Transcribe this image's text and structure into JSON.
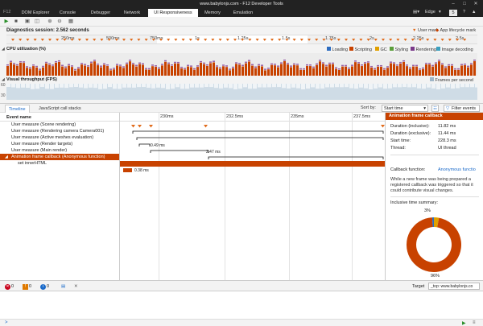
{
  "window": {
    "title": "www.babylonjs.com - F12 Developer Tools"
  },
  "menubar": {
    "tool_id": "F12",
    "tabs": [
      {
        "label": "DOM Explorer",
        "active": false
      },
      {
        "label": "Console",
        "active": false
      },
      {
        "label": "Debugger",
        "active": false
      },
      {
        "label": "Network",
        "active": false
      },
      {
        "label": "UI Responsiveness",
        "active": true
      },
      {
        "label": "Memory",
        "active": false
      },
      {
        "label": "Emulation",
        "active": false
      }
    ],
    "browser": "Edge",
    "counter": "5"
  },
  "session": {
    "label": "Diagnostics session: 2.562 seconds",
    "legend_user_mark": "User mark",
    "legend_lifecycle_mark": "App lifecycle mark",
    "ruler_ticks": [
      "250ms",
      "500ms",
      "750ms",
      "1s",
      "1.25s",
      "1.5s",
      "1.75s",
      "2s",
      "2.25s",
      "2.5s"
    ]
  },
  "cpu": {
    "title": "CPU utilization (%)",
    "legend": [
      {
        "label": "Loading",
        "color": "#2d6cc0"
      },
      {
        "label": "Scripting",
        "color": "#c84200"
      },
      {
        "label": "GC",
        "color": "#e0a000"
      },
      {
        "label": "Styling",
        "color": "#5a9e3a"
      },
      {
        "label": "Rendering",
        "color": "#7a3a8a"
      },
      {
        "label": "Image decoding",
        "color": "#3aa0c0"
      }
    ]
  },
  "fps": {
    "title": "Visual throughput (FPS)",
    "legend": "Frames per second",
    "axis_top": "60",
    "axis_bottom": "30"
  },
  "details_tabs": {
    "timeline": "Timeline",
    "callstacks": "JavaScript call stacks",
    "sort_by": "Sort by:",
    "sort_value": "Start time",
    "filter": "Filter events"
  },
  "events": {
    "header": "Event name",
    "rows": [
      {
        "name": "User measure (Scene rendering)"
      },
      {
        "name": "User measure (Rendering camera Camera001)"
      },
      {
        "name": "User measure (Active meshes evaluation)",
        "duration": "0.49 ms"
      },
      {
        "name": "User measure (Render targets)",
        "duration": "2.47 ms"
      },
      {
        "name": "User measure (Main render)"
      },
      {
        "name": "Animation frame callback (Anonymous function)"
      },
      {
        "name": "set innerHTML",
        "duration": "0.38 ms"
      }
    ]
  },
  "timeline": {
    "ticks": [
      "230ms",
      "232.5ms",
      "235ms",
      "237.5ms"
    ]
  },
  "details": {
    "title": "Animation frame callback",
    "duration_inclusive_label": "Duration (inclusive):",
    "duration_inclusive": "11.82 ms",
    "duration_exclusive_label": "Duration (exclusive):",
    "duration_exclusive": "11.44 ms",
    "start_time_label": "Start time:",
    "start_time": "228.3 ms",
    "thread_label": "Thread:",
    "thread": "UI thread",
    "callback_label": "Callback function:",
    "callback_value": "Anonymous functio",
    "description": "While a new frame was being prepared a registered callback was triggered so that it could contribute visual changes.",
    "summary_title": "Inclusive time summary:",
    "pie": [
      {
        "label": "3%",
        "value": 3,
        "color": "#e0a000"
      },
      {
        "label": "96%",
        "value": 96,
        "color": "#c84200"
      },
      {
        "label": "",
        "value": 1,
        "color": "#2d6cc0"
      }
    ]
  },
  "console": {
    "errors": "0",
    "warnings": "0",
    "messages": "0",
    "target_label": "Target",
    "target_value": "_top: www.babylonjs.co"
  }
}
